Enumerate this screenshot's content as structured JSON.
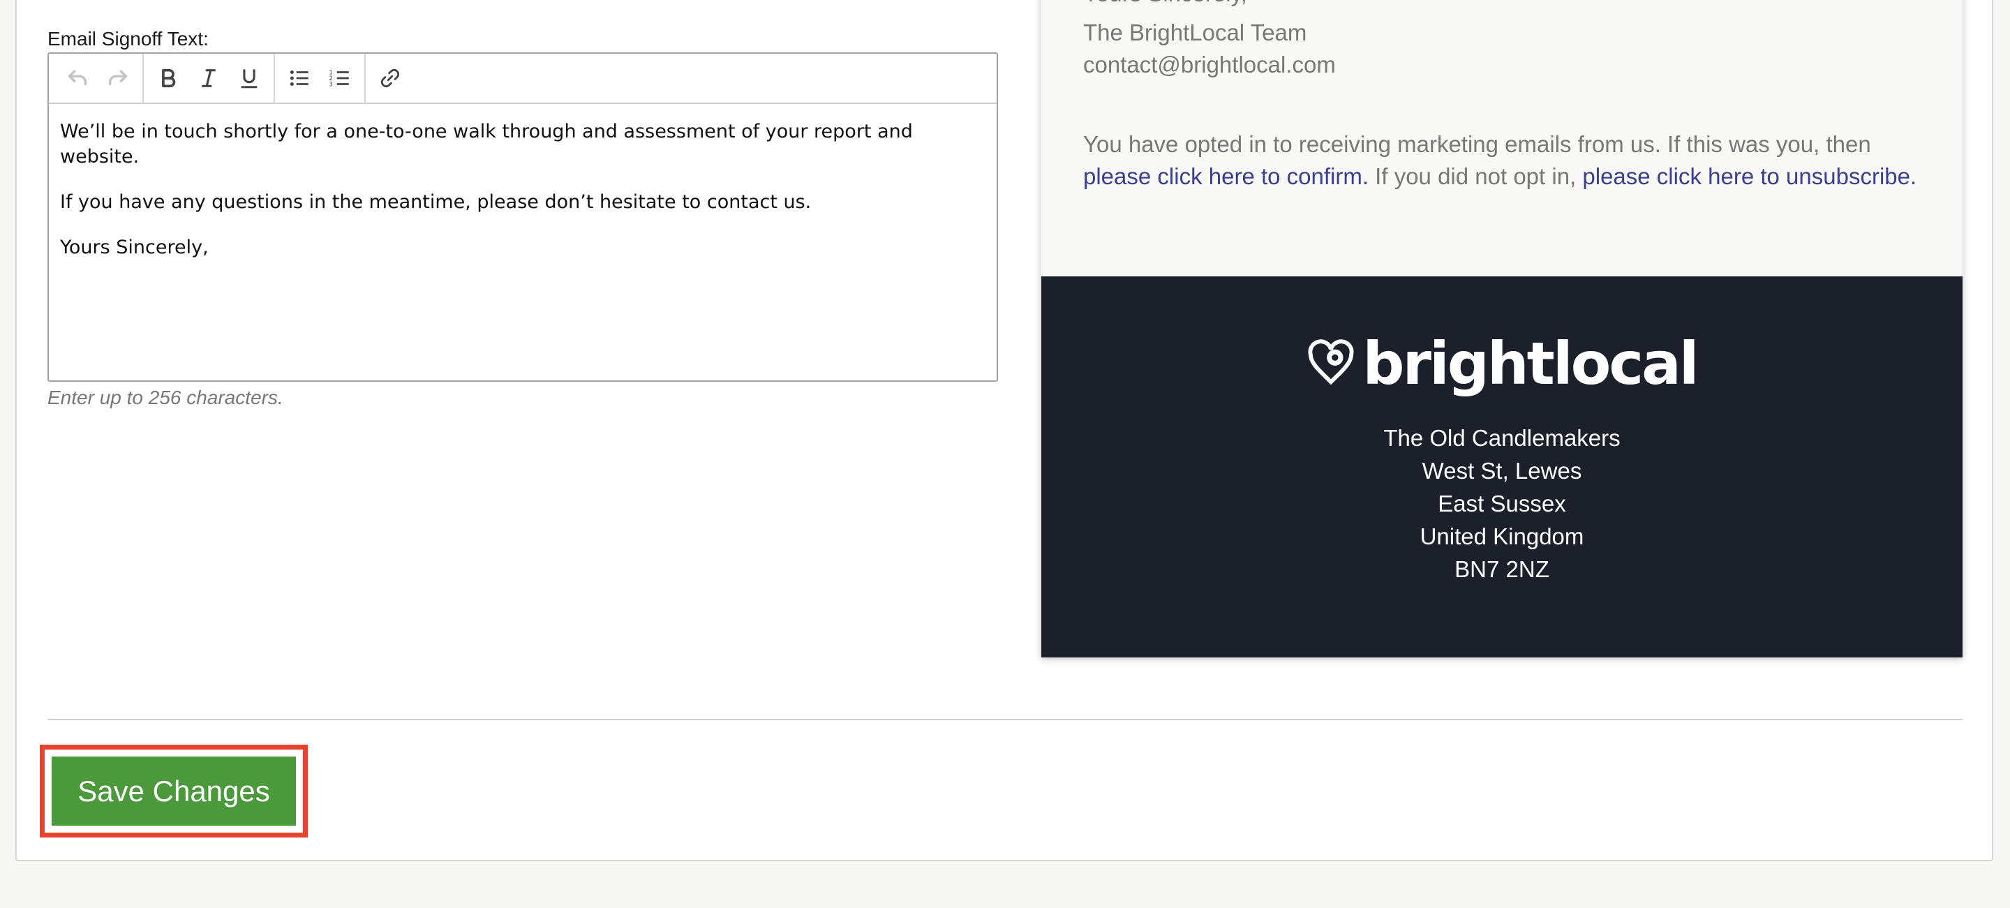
{
  "editor": {
    "label": "Email Signoff Text:",
    "toolbar": {
      "undo": "undo-icon",
      "redo": "redo-icon",
      "bold": "bold-icon",
      "italic": "italic-icon",
      "underline": "underline-icon",
      "bullets": "bulleted-list-icon",
      "numbered": "numbered-list-icon",
      "link": "link-icon"
    },
    "paragraphs": [
      "We’ll be in touch shortly for a one-to-one walk through and assessment of your report and website.",
      "If you have any questions in the meantime, please don’t hesitate to contact us.",
      "Yours Sincerely,"
    ],
    "hint": "Enter up to 256 characters."
  },
  "preview": {
    "cut_line": "Yours Sincerely,",
    "team": "The BrightLocal Team",
    "email": "contact@brightlocal.com",
    "optin_text_1": "You have opted in to receiving marketing emails from us. If this was you, then",
    "confirm_link": "please click here to confirm.",
    "optin_text_2": " If you did not opt in, ",
    "unsubscribe_link": "please click here to unsubscribe.",
    "logo_text": "brightlocal",
    "address": [
      "The Old Candlemakers",
      "West St, Lewes",
      "East Sussex",
      "United Kingdom",
      "BN7 2NZ"
    ]
  },
  "actions": {
    "save_label": "Save Changes"
  },
  "colors": {
    "accent_green": "#4a9a3c",
    "highlight_red": "#e8432c",
    "footer_dark": "#1b202b",
    "link_blue": "#3b3f8f"
  }
}
